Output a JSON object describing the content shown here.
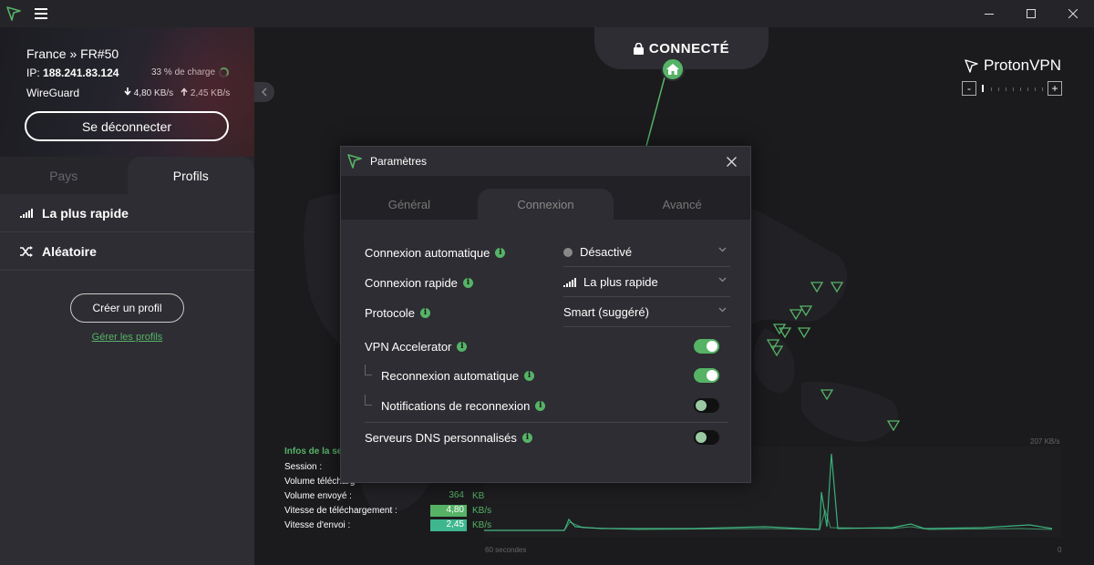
{
  "titlebar": {
    "menu_icon": "hamburger-icon"
  },
  "connection": {
    "server": "France » FR#50",
    "ip_label": "IP:",
    "ip": "188.241.83.124",
    "load": "33 % de charge",
    "protocol": "WireGuard",
    "download": "4,80 KB/s",
    "upload": "2,45 KB/s",
    "disconnect": "Se déconnecter"
  },
  "sidebar": {
    "tabs": [
      "Pays",
      "Profils"
    ],
    "profiles": [
      {
        "label": "La plus rapide",
        "icon": "signal-bars-icon"
      },
      {
        "label": "Aléatoire",
        "icon": "shuffle-icon"
      }
    ],
    "create_profile": "Créer un profil",
    "manage_profiles": "Gérer les profils"
  },
  "map": {
    "status": "CONNECTÉ",
    "brand": "ProtonVPN",
    "zoom_minus": "-",
    "zoom_plus": "+"
  },
  "stats": {
    "title": "Infos de la se",
    "rows": [
      {
        "label": "Session :",
        "value": "",
        "unit": ""
      },
      {
        "label": "Volume télécharg",
        "value": "",
        "unit": ""
      },
      {
        "label": "Volume envoyé :",
        "value": "364",
        "unit": "KB"
      },
      {
        "label": "Vitesse de téléchargement :",
        "value": "4,80",
        "unit": "KB/s"
      },
      {
        "label": "Vitesse d'envoi :",
        "value": "2,45",
        "unit": "KB/s"
      }
    ],
    "chart_max": "207 KB/s",
    "chart_left": "60 secondes",
    "chart_right": "0"
  },
  "modal": {
    "title": "Paramètres",
    "tabs": [
      "Général",
      "Connexion",
      "Avancé"
    ],
    "settings": {
      "auto_connect": {
        "label": "Connexion automatique",
        "value": "Désactivé"
      },
      "quick_connect": {
        "label": "Connexion rapide",
        "value": "La plus rapide"
      },
      "protocol": {
        "label": "Protocole",
        "value": "Smart (suggéré)"
      },
      "vpn_accelerator": {
        "label": "VPN Accelerator",
        "enabled": true
      },
      "auto_reconnect": {
        "label": "Reconnexion automatique",
        "enabled": true
      },
      "reconnect_notifications": {
        "label": "Notifications de reconnexion",
        "enabled": false
      },
      "custom_dns": {
        "label": "Serveurs DNS personnalisés",
        "enabled": false
      }
    }
  },
  "colors": {
    "accent": "#56b366",
    "background": "#1b1b1e",
    "panel": "#2d2d33"
  }
}
